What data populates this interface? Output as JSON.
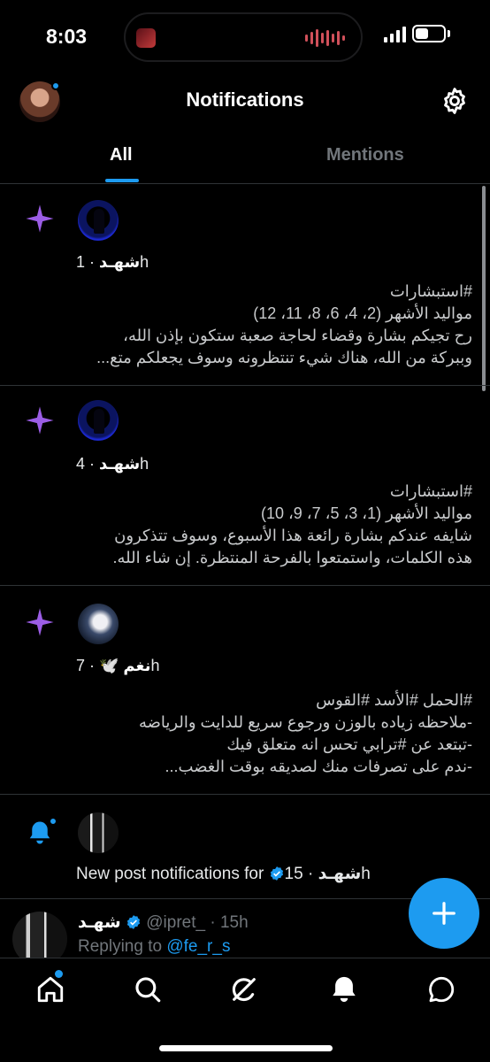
{
  "status_bar": {
    "time": "8:03"
  },
  "header": {
    "title": "Notifications"
  },
  "tabs": [
    {
      "label": "All",
      "active": true
    },
    {
      "label": "Mentions",
      "active": false
    }
  ],
  "notifications": [
    {
      "type": "recommended",
      "name": "شهـد",
      "meta": " · 1h",
      "text": "#استبشارات\nمواليد الأشهر (2، 4، 6، 8، 11، 12)\nرح تجيكم بشارة وقضاء لحاجة صعبة ستكون بإذن الله،\nوببركة من الله، هناك شيء تنتظرونه وسوف يجعلكم متع..."
    },
    {
      "type": "recommended",
      "name": "شهـد",
      "meta": " · 4h",
      "text": "#استبشارات\nمواليد الأشهر (1، 3، 5، 7، 9، 10)\nشايفه عندكم بشارة رائعة هذا الأسبوع، وسوف تتذكرون\nهذه الكلمات، واستمتعوا بالفرحة المنتظرة. إن شاء الله."
    },
    {
      "type": "recommended",
      "name": "نغم 🕊️",
      "meta": " · 7h",
      "text": "#الحمل #الأسد #القوس\n-ملاحظه زياده بالوزن ورجوع سريع للدايت والرياضه\n-تبتعد عن #ترابي تحس انه متعلق فيك\n-ندم على تصرفات منك لصديقه بوقت الغضب..."
    },
    {
      "type": "new_post",
      "prefix": "New post notifications for ",
      "name": "شهـد",
      "meta": " · 15h"
    }
  ],
  "tweet": {
    "name": "شهـد",
    "handle": "@ipret_",
    "time": " · 15h",
    "replying_prefix": "Replying to ",
    "replying_to": "@fe_r_s"
  },
  "colors": {
    "accent": "#1d9bf0",
    "sparkle": "#9b5de5",
    "background": "#000000"
  },
  "icons": [
    "settings-gear-icon",
    "sparkle-icon",
    "bell-icon",
    "verified-badge-icon",
    "compose-plus-icon",
    "home-icon",
    "search-icon",
    "grok-icon",
    "notifications-icon",
    "messages-icon"
  ]
}
